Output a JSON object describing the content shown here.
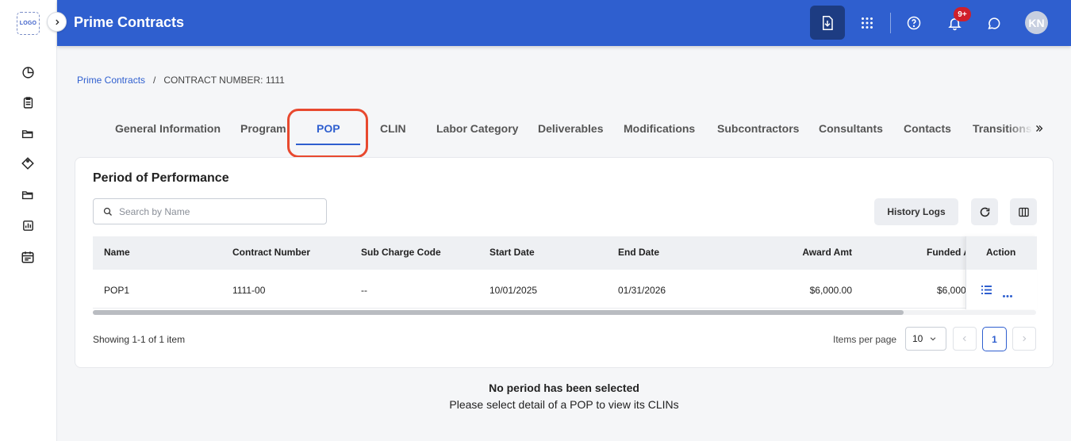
{
  "app": {
    "logo_text": "LOGO",
    "title": "Prime Contracts",
    "notification_badge": "9+",
    "avatar_initials": "KN"
  },
  "sidebar": {
    "items": [
      {
        "icon": "pie-chart-icon"
      },
      {
        "icon": "clipboard-list-icon"
      },
      {
        "icon": "folder-open-icon"
      },
      {
        "icon": "tag-icon"
      },
      {
        "icon": "folder-open-icon"
      },
      {
        "icon": "bar-chart-icon"
      },
      {
        "icon": "calendar-icon"
      }
    ]
  },
  "header": {
    "icons": [
      "download-document-icon",
      "app-grid-icon",
      "help-icon",
      "bell-icon",
      "chat-icon"
    ]
  },
  "breadcrumb": {
    "root": "Prime Contracts",
    "separator": "/",
    "current": "CONTRACT NUMBER: 1111"
  },
  "tabs": [
    "General Information",
    "Program",
    "POP",
    "CLIN",
    "Labor Category",
    "Deliverables",
    "Modifications",
    "Subcontractors",
    "Consultants",
    "Contacts",
    "Transitions"
  ],
  "active_tab": "POP",
  "card": {
    "title": "Period of Performance",
    "search_placeholder": "Search by Name",
    "history_button": "History Logs"
  },
  "table": {
    "columns": [
      "Name",
      "Contract Number",
      "Sub Charge Code",
      "Start Date",
      "End Date",
      "Award Amt",
      "Funded A",
      "Action"
    ],
    "rows": [
      {
        "name": "POP1",
        "contract_number": "1111-00",
        "sub_charge_code": "--",
        "start_date": "10/01/2025",
        "end_date": "01/31/2026",
        "award_amt": "$6,000.00",
        "funded_amt": "$6,000"
      }
    ]
  },
  "footer": {
    "showing": "Showing 1-1 of 1 item",
    "items_per_page_label": "Items per page",
    "items_per_page_value": "10",
    "current_page": "1"
  },
  "empty_state": {
    "title": "No period has been selected",
    "subtitle": "Please select detail of a POP to view its CLINs"
  },
  "colors": {
    "brand": "#2f5fcf",
    "header_active": "#1d3c82",
    "highlight": "#e8492f",
    "badge": "#d0202b"
  }
}
